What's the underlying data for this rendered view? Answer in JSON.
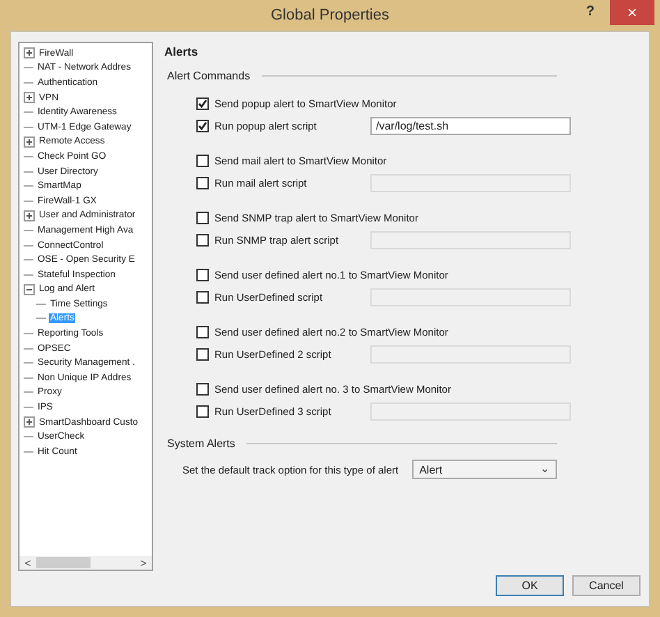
{
  "window": {
    "title": "Global Properties",
    "help": "?",
    "close": "×"
  },
  "tree": {
    "items": [
      {
        "label": "FireWall",
        "expanded": false,
        "selected": false
      },
      {
        "label": "NAT - Network Addres",
        "selected": false
      },
      {
        "label": "Authentication",
        "selected": false
      },
      {
        "label": "VPN",
        "expanded": false,
        "selected": false
      },
      {
        "label": "Identity Awareness",
        "selected": false
      },
      {
        "label": "UTM-1 Edge Gateway",
        "selected": false
      },
      {
        "label": "Remote Access",
        "expanded": false,
        "selected": false
      },
      {
        "label": "Check Point GO",
        "selected": false
      },
      {
        "label": "User Directory",
        "selected": false
      },
      {
        "label": "SmartMap",
        "selected": false
      },
      {
        "label": "FireWall-1 GX",
        "selected": false
      },
      {
        "label": "User and Administrator",
        "expanded": false,
        "selected": false
      },
      {
        "label": "Management High Ava",
        "selected": false
      },
      {
        "label": "ConnectControl",
        "selected": false
      },
      {
        "label": "OSE - Open Security E",
        "selected": false
      },
      {
        "label": "Stateful Inspection",
        "selected": false
      },
      {
        "label": "Log and Alert",
        "expanded": true,
        "selected": false,
        "children": [
          {
            "label": "Time Settings",
            "selected": false
          },
          {
            "label": "Alerts",
            "selected": true
          }
        ]
      },
      {
        "label": "Reporting Tools",
        "selected": false
      },
      {
        "label": "OPSEC",
        "selected": false
      },
      {
        "label": "Security Management .",
        "selected": false
      },
      {
        "label": "Non Unique IP Addres",
        "selected": false
      },
      {
        "label": "Proxy",
        "selected": false
      },
      {
        "label": "IPS",
        "selected": false
      },
      {
        "label": "SmartDashboard Custo",
        "expanded": false,
        "selected": false
      },
      {
        "label": "UserCheck",
        "selected": false
      },
      {
        "label": "Hit Count",
        "selected": false
      }
    ],
    "scroll_left": "<",
    "scroll_right": ">"
  },
  "page": {
    "title": "Alerts",
    "alert_commands": {
      "title": "Alert Commands",
      "groups": [
        {
          "send": {
            "label": "Send popup alert to SmartView Monitor",
            "checked": true
          },
          "run": {
            "label": "Run popup alert script",
            "checked": true,
            "value": "/var/log/test.sh",
            "disabled": false
          }
        },
        {
          "send": {
            "label": "Send mail alert to SmartView Monitor",
            "checked": false
          },
          "run": {
            "label": "Run mail alert script",
            "checked": false,
            "disabled": true
          }
        },
        {
          "send": {
            "label": "Send SNMP trap alert to SmartView Monitor",
            "checked": false
          },
          "run": {
            "label": "Run SNMP trap alert script",
            "checked": false,
            "disabled": true
          }
        },
        {
          "send": {
            "label": "Send user defined alert no.1 to SmartView Monitor",
            "checked": false
          },
          "run": {
            "label": "Run UserDefined script",
            "checked": false,
            "disabled": true
          }
        },
        {
          "send": {
            "label": "Send user defined alert no.2 to SmartView Monitor",
            "checked": false
          },
          "run": {
            "label": "Run UserDefined 2 script",
            "checked": false,
            "disabled": true
          }
        },
        {
          "send": {
            "label": "Send user defined alert no. 3 to SmartView Monitor",
            "checked": false
          },
          "run": {
            "label": "Run UserDefined 3 script",
            "checked": false,
            "disabled": true
          }
        }
      ]
    },
    "system_alerts": {
      "title": "System Alerts",
      "label": "Set the default track option for this type of alert",
      "value": "Alert",
      "caret": "⌄"
    }
  },
  "buttons": [
    {
      "label": "OK",
      "default": true
    },
    {
      "label": "Cancel",
      "default": false
    }
  ]
}
